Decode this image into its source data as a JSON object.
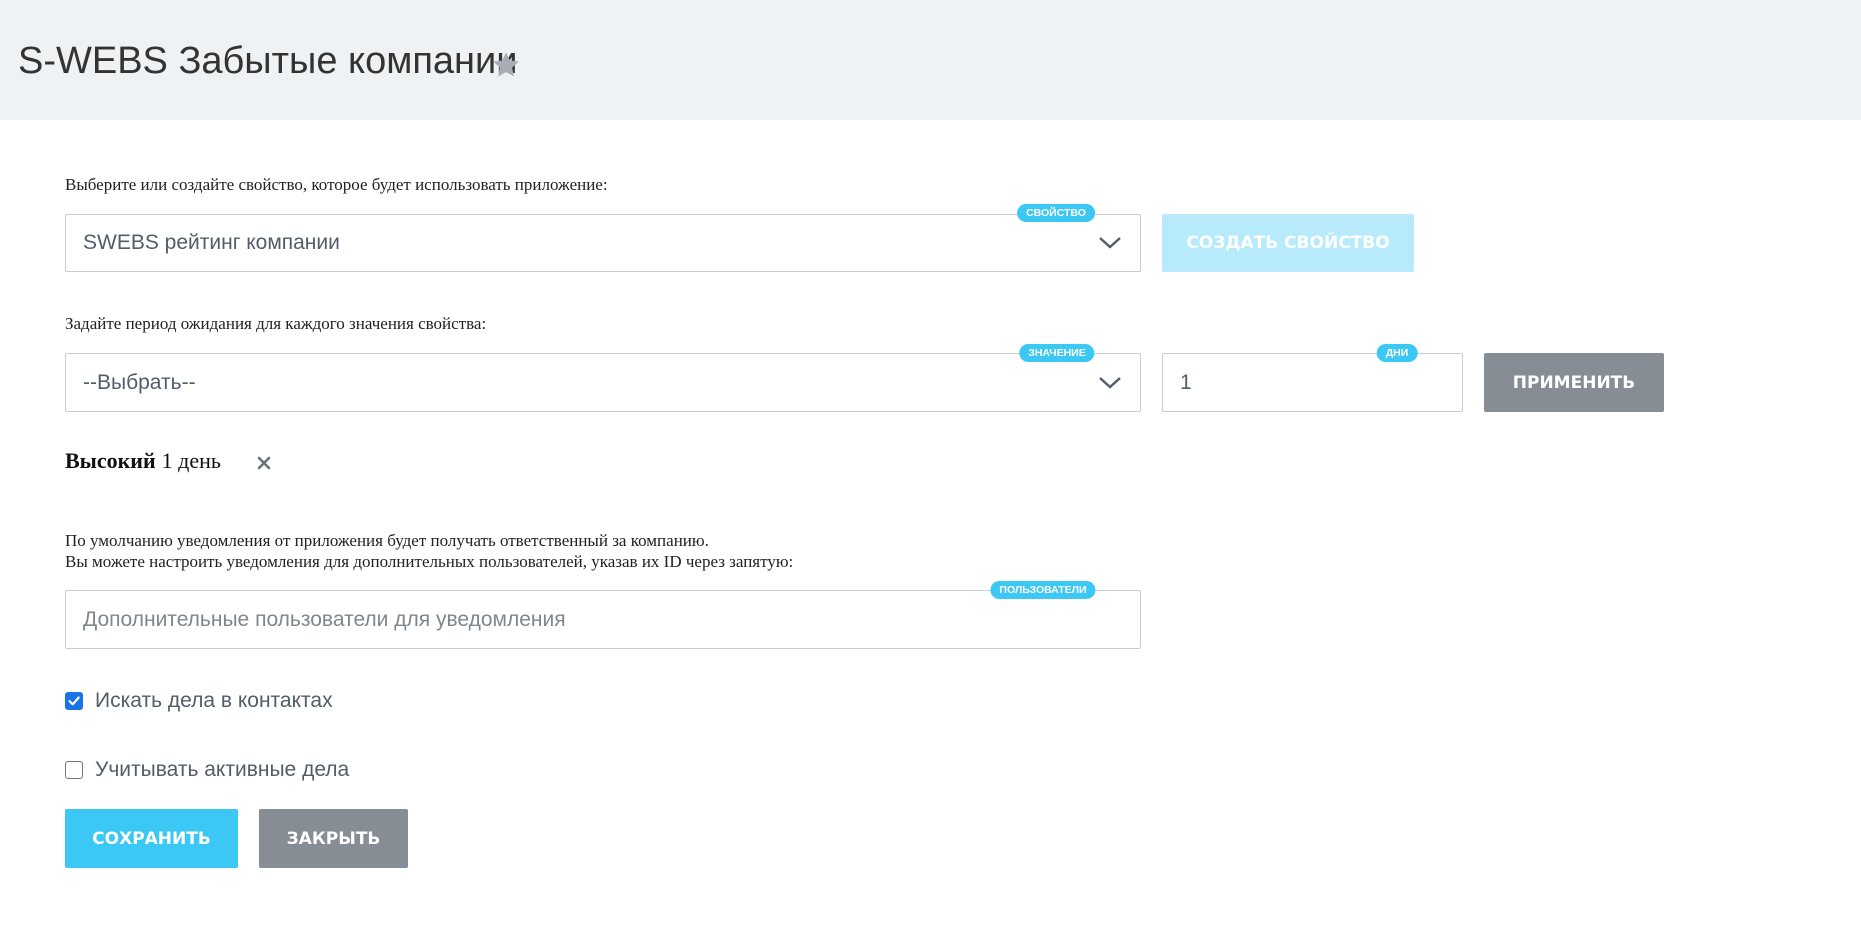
{
  "header": {
    "title": "S-WEBS Забытые компании",
    "favorite_icon": "star-icon"
  },
  "property": {
    "label": "Выберите или создайте свойство, которое будет использовать приложение:",
    "badge": "СВОЙСТВО",
    "selected": "SWEBS рейтинг компании",
    "create_button": "СОЗДАТЬ СВОЙСТВО"
  },
  "period": {
    "label": "Задайте период ожидания для каждого значения свойства:",
    "value_badge": "ЗНАЧЕНИЕ",
    "value_selected": "--Выбрать--",
    "days_badge": "ДНИ",
    "days_value": "1",
    "apply_button": "ПРИМЕНИТЬ"
  },
  "tags": [
    {
      "name": "Высокий",
      "value": "1 день",
      "remove_icon": "close-icon"
    }
  ],
  "notifications": {
    "line1": "По умолчанию уведомления от приложения будет получать ответственный за компанию.",
    "line2": "Вы можете настроить уведомления для дополнительных пользователей, указав их ID через запятую:",
    "badge": "ПОЛЬЗОВАТЕЛИ",
    "placeholder": "Дополнительные пользователи для уведомления"
  },
  "options": [
    {
      "label": "Искать дела в контактах",
      "checked": true
    },
    {
      "label": "Учитывать активные дела",
      "checked": false
    }
  ],
  "footer": {
    "save_button": "СОХРАНИТЬ",
    "close_button": "ЗАКРЫТЬ"
  },
  "colors": {
    "accent": "#3bc8f5",
    "accent_light": "#b7ebfb",
    "gray_button": "#868d95",
    "header_bg": "#eef2f4"
  }
}
